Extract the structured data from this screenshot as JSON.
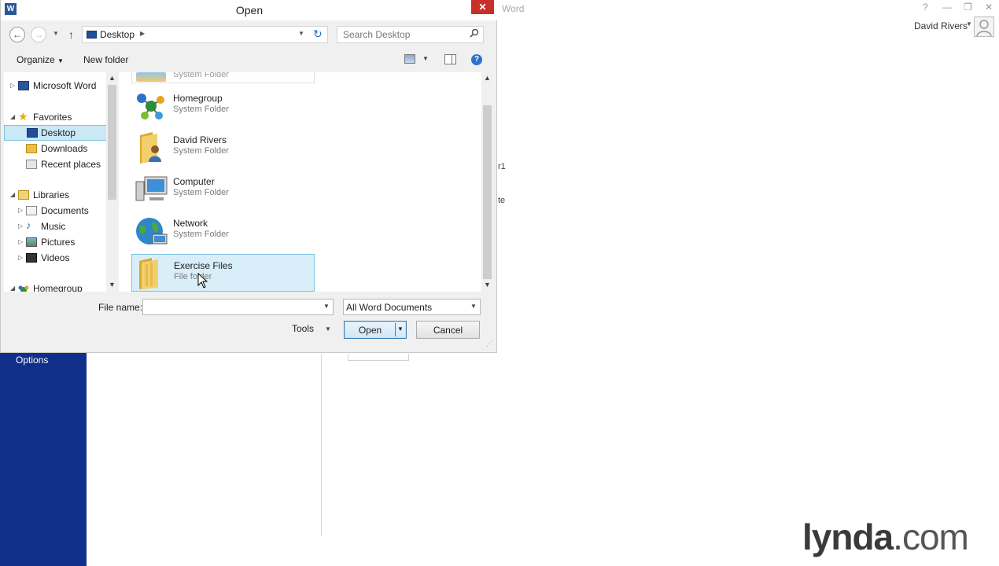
{
  "word": {
    "title": "Word",
    "user_name": "David Rivers",
    "sidebar_item": "Options",
    "text_fragment_1": "r1",
    "text_fragment_2": "te"
  },
  "logo": {
    "text_main": "lynda",
    "text_dot": ".",
    "text_com": "com"
  },
  "dialog": {
    "title": "Open",
    "address": {
      "location": "Desktop"
    },
    "search": {
      "placeholder": "Search Desktop"
    },
    "toolbar": {
      "organize": "Organize",
      "new_folder": "New folder"
    },
    "nav": {
      "items": [
        {
          "label": "Microsoft Word",
          "level": 0
        },
        {
          "label": "Favorites",
          "level": 0
        },
        {
          "label": "Desktop",
          "level": 1,
          "selected": true
        },
        {
          "label": "Downloads",
          "level": 1
        },
        {
          "label": "Recent places",
          "level": 1
        },
        {
          "label": "Libraries",
          "level": 0
        },
        {
          "label": "Documents",
          "level": 1
        },
        {
          "label": "Music",
          "level": 1
        },
        {
          "label": "Pictures",
          "level": 1
        },
        {
          "label": "Videos",
          "level": 1
        },
        {
          "label": "Homegroup",
          "level": 0
        }
      ]
    },
    "files": {
      "partial_type": "System Folder",
      "items": [
        {
          "name": "Homegroup",
          "type": "System Folder",
          "icon": "homegroup-icon"
        },
        {
          "name": "David Rivers",
          "type": "System Folder",
          "icon": "user-folder-icon"
        },
        {
          "name": "Computer",
          "type": "System Folder",
          "icon": "computer-icon"
        },
        {
          "name": "Network",
          "type": "System Folder",
          "icon": "network-globe-icon"
        },
        {
          "name": "Exercise Files",
          "type": "File folder",
          "icon": "folder-icon",
          "selected": true
        }
      ]
    },
    "bottom": {
      "file_name_label": "File name:",
      "file_name_value": "",
      "file_type": "All Word Documents",
      "tools": "Tools",
      "open": "Open",
      "cancel": "Cancel"
    }
  },
  "colors": {
    "word_blue": "#0f2f8a",
    "selection": "#cbe8f6",
    "close_red": "#c7312a"
  }
}
